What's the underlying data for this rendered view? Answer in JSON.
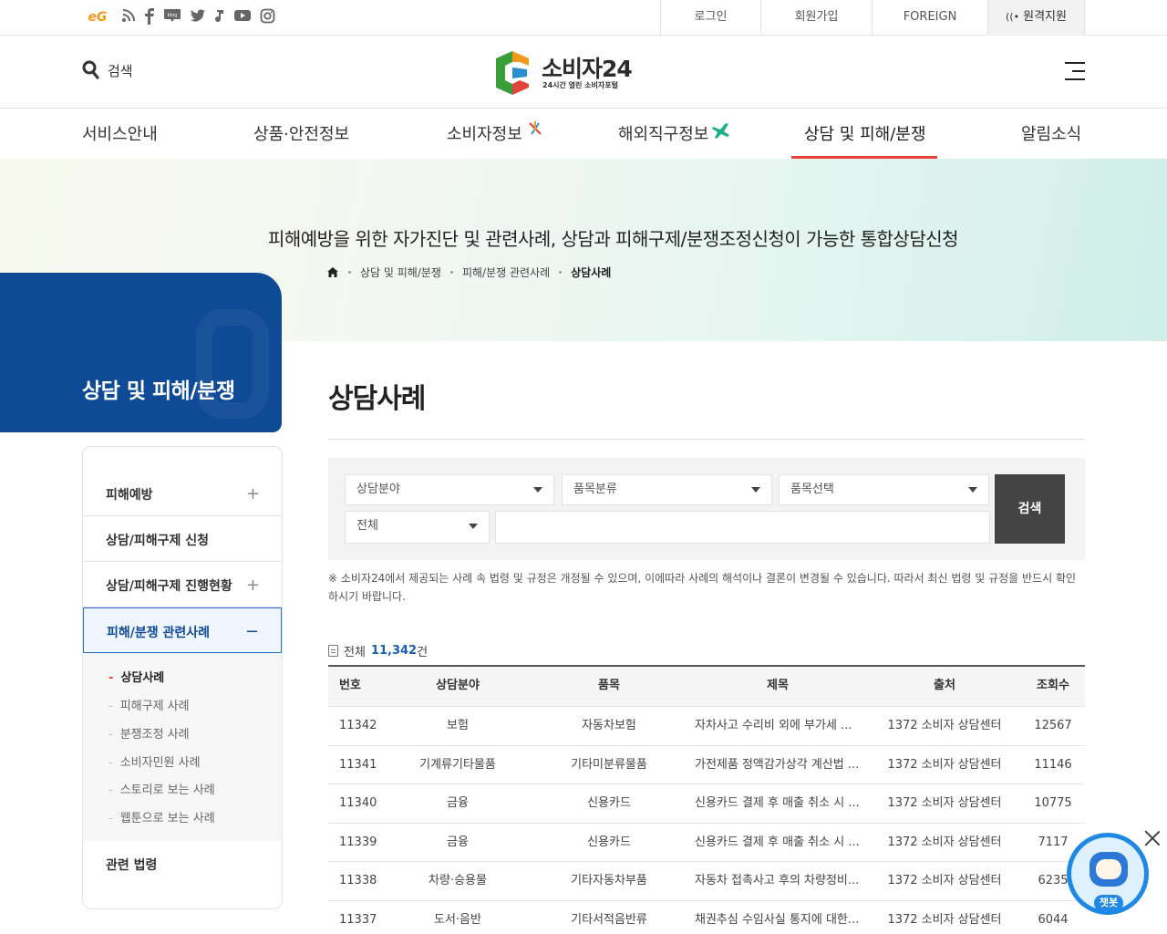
{
  "sns": {
    "ec_logo": "eG",
    "icons": [
      "rss-icon",
      "facebook-icon",
      "blog-icon",
      "twitter-icon",
      "music-icon",
      "youtube-icon",
      "instagram-icon"
    ]
  },
  "util": {
    "login": "로그인",
    "join": "회원가입",
    "foreign": "FOREIGN",
    "remote": "원격지원"
  },
  "header": {
    "search_label": "검색",
    "logo_main": "소비자24",
    "logo_sub": "24시간 열린 소비자포털"
  },
  "gnb": {
    "items": [
      "서비스안내",
      "상품·안전정보",
      "소비자정보",
      "해외직구정보",
      "상담 및 피해/분쟁",
      "알림소식"
    ],
    "active_index": 4,
    "accent_color": "#e8413c"
  },
  "hero": {
    "title": "피해예방을 위한 자가진단 및 관련사례, 상담과 피해구제/분쟁조정신청이 가능한 통합상담신청",
    "breadcrumb": [
      "상담 및 피해/분쟁",
      "피해/분쟁 관련사례",
      "상담사례"
    ]
  },
  "side": {
    "title": "상담 및 피해/분쟁",
    "menu": [
      {
        "label": "피해예방",
        "toggle": "+"
      },
      {
        "label": "상담/피해구제 신청",
        "toggle": ""
      },
      {
        "label": "상담/피해구제 진행현황",
        "toggle": "+"
      },
      {
        "label": "피해/분쟁 관련사례",
        "toggle": "−"
      },
      {
        "label": "관련 법령",
        "toggle": ""
      }
    ],
    "submenu": [
      "상담사례",
      "피해구제 사례",
      "분쟁조정 사례",
      "소비자민원 사례",
      "스토리로 보는 사례",
      "웹툰으로 보는 사례"
    ],
    "brand_color": "#0f4a96"
  },
  "content": {
    "title": "상담사례",
    "filter": {
      "field": "상담분야",
      "category": "품목분류",
      "item": "품목선택",
      "scope": "전체",
      "keyword": "",
      "search_button": "검색"
    },
    "notice": "※ 소비자24에서 제공되는 사례 속 법령 및 규정은 개정될 수 있으며, 이에따라 사례의 해석이나 결론이 변경될 수 있습니다. 따라서 최신 법령 및 규정을 반드시 확인하시기 바랍니다.",
    "total_label": "전체",
    "total_count": "11,342",
    "total_unit": "건",
    "table": {
      "headers": [
        "번호",
        "상담분야",
        "품목",
        "제목",
        "출처",
        "조회수"
      ],
      "rows": [
        [
          "11342",
          "보험",
          "자동차보험",
          "자차사고 수리비 외에 부가세 ...",
          "1372 소비자 상담센터",
          "12567"
        ],
        [
          "11341",
          "기계류기타물품",
          "기타미분류물품",
          "가전제품 정액감가상각 계산법 ...",
          "1372 소비자 상담센터",
          "11146"
        ],
        [
          "11340",
          "금융",
          "신용카드",
          "신용카드 결제 후 매출 취소 시 ...",
          "1372 소비자 상담센터",
          "10775"
        ],
        [
          "11339",
          "금융",
          "신용카드",
          "신용카드 결제 후 매출 취소 시 ...",
          "1372 소비자 상담센터",
          "7117"
        ],
        [
          "11338",
          "차량·승용물",
          "기타자동차부품",
          "자동차 접촉사고 후의 차량정비...",
          "1372 소비자 상담센터",
          "6235"
        ],
        [
          "11337",
          "도서·음반",
          "기타서적음반류",
          "채권추심 수임사실 통지에 대한...",
          "1372 소비자 상담센터",
          "6044"
        ]
      ]
    }
  },
  "chatbot": {
    "label": "챗봇"
  }
}
